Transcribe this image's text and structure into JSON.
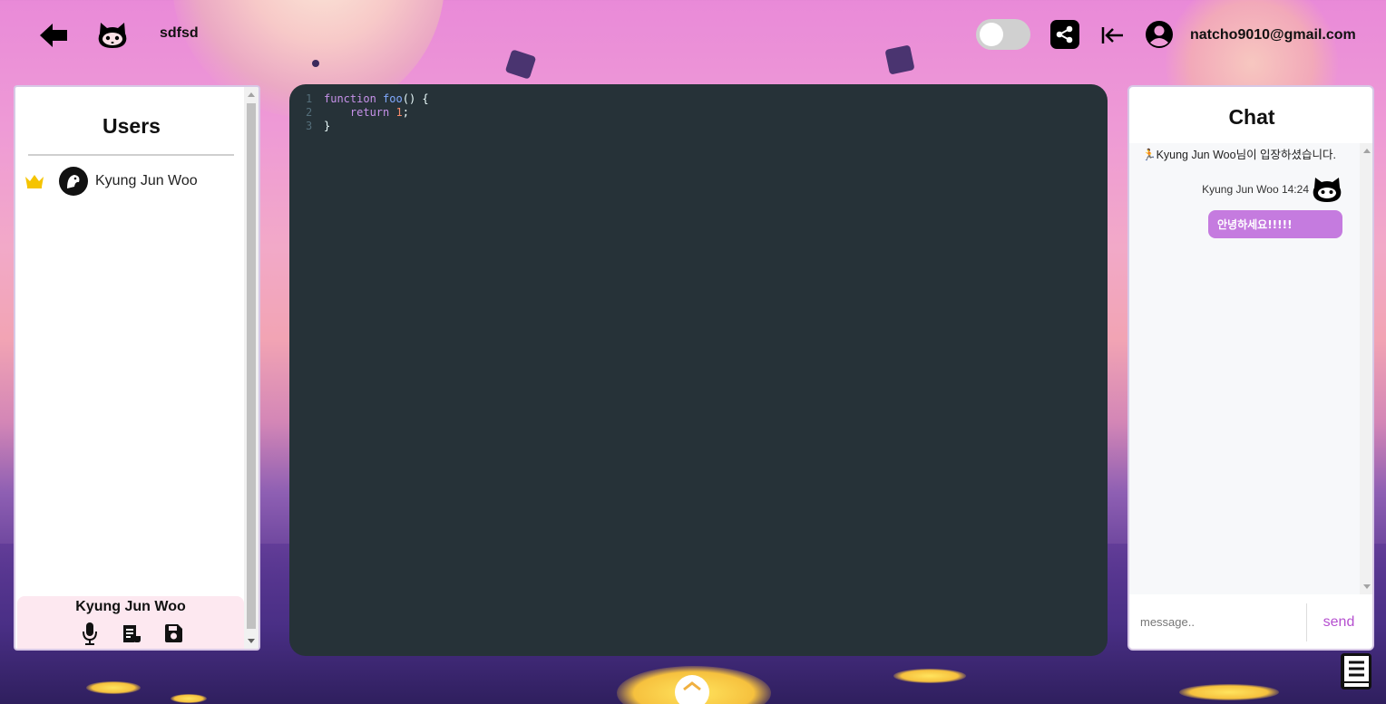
{
  "topbar": {
    "room_name": "sdfsd",
    "email": "natcho9010@gmail.com",
    "icons": [
      "back-arrow-icon",
      "octocat-logo-icon",
      "toggle-switch",
      "share-icon",
      "logout-icon",
      "account-circle-icon"
    ],
    "toggle_on": false
  },
  "users": {
    "title": "Users",
    "list": [
      {
        "name": "Kyung Jun Woo",
        "is_host": true
      }
    ],
    "me": {
      "name": "Kyung Jun Woo",
      "actions": [
        "microphone-icon",
        "notes-icon",
        "save-icon"
      ]
    }
  },
  "editor": {
    "lines": [
      {
        "num": "1",
        "code": "function foo() {"
      },
      {
        "num": "2",
        "code": "    return 1;"
      },
      {
        "num": "3",
        "code": "}"
      }
    ],
    "background": "#263238"
  },
  "chat": {
    "title": "Chat",
    "system_message": "🏃Kyung Jun Woo님이 입장하셨습니다.",
    "messages": [
      {
        "sender": "Kyung Jun Woo",
        "time": "14:24",
        "meta": "Kyung Jun Woo 14:24",
        "text": "안녕하세요!!!!!"
      }
    ],
    "input_placeholder": "message..",
    "send_label": "send",
    "accent": "#c57bdf"
  },
  "colors": {
    "send_text": "#b54fcf",
    "crown": "#f5c400"
  }
}
